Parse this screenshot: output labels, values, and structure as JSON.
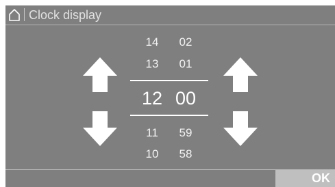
{
  "header": {
    "title": "Clock display",
    "home_icon": "home-icon"
  },
  "hours": {
    "above2": "14",
    "above1": "13",
    "current": "12",
    "below1": "11",
    "below2": "10"
  },
  "minutes": {
    "above2": "02",
    "above1": "01",
    "current": "00",
    "below1": "59",
    "below2": "58"
  },
  "icons": {
    "hours_up": "arrow-up-icon",
    "hours_down": "arrow-down-icon",
    "minutes_up": "arrow-up-icon",
    "minutes_down": "arrow-down-icon"
  },
  "footer": {
    "ok_label": "OK"
  },
  "colors": {
    "screen_bg": "#7f7f7f",
    "text": "#ffffff",
    "ok_bg": "#bfbfbf"
  }
}
